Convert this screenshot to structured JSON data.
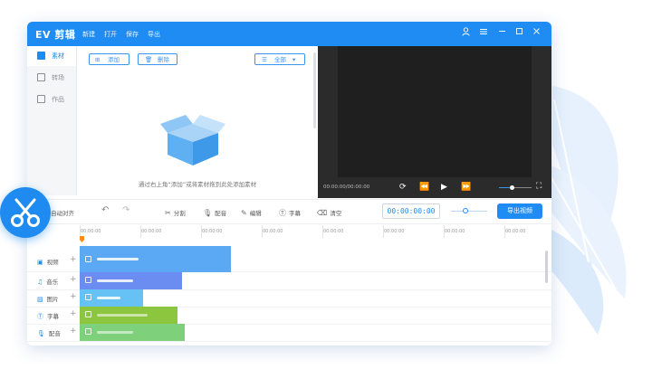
{
  "app": {
    "brand": "EV 剪辑",
    "menu": [
      "新建",
      "打开",
      "保存",
      "导出"
    ]
  },
  "sidebar": {
    "items": [
      {
        "label": "素材",
        "active": true
      },
      {
        "label": "转场",
        "active": false
      },
      {
        "label": "作品",
        "active": false
      }
    ]
  },
  "media": {
    "add_label": "添加",
    "delete_label": "删除",
    "filter_label": "全部",
    "empty_hint": "通过右上角“添加”或将素材拖到此处添加素材"
  },
  "preview": {
    "timecode": "00:00:00/00:00:00",
    "volume": 0.4
  },
  "toolbar": {
    "auto_align": "自动对齐",
    "split": "分割",
    "dub": "配音",
    "edit": "编辑",
    "subtitle": "字幕",
    "clear": "清空",
    "current_time": "00:00:00:00",
    "export_label": "导出视频",
    "zoom": 0.4
  },
  "ruler": {
    "ticks": [
      "00:00:00",
      "00:00:00",
      "00:00:00",
      "00:00:00",
      "00:00:00",
      "00:00:00",
      "00:00:00",
      "00:00:00"
    ]
  },
  "tracks": [
    {
      "label": "视频",
      "color": "#5ba8f5"
    },
    {
      "label": "音乐",
      "color": "#6b8cf0"
    },
    {
      "label": "图片",
      "color": "#66c2f5"
    },
    {
      "label": "字幕",
      "color": "#8cc63f"
    },
    {
      "label": "配音",
      "color": "#7ed07a"
    }
  ],
  "colors": {
    "accent": "#1e8cf2",
    "playhead": "#ff8c1a"
  }
}
